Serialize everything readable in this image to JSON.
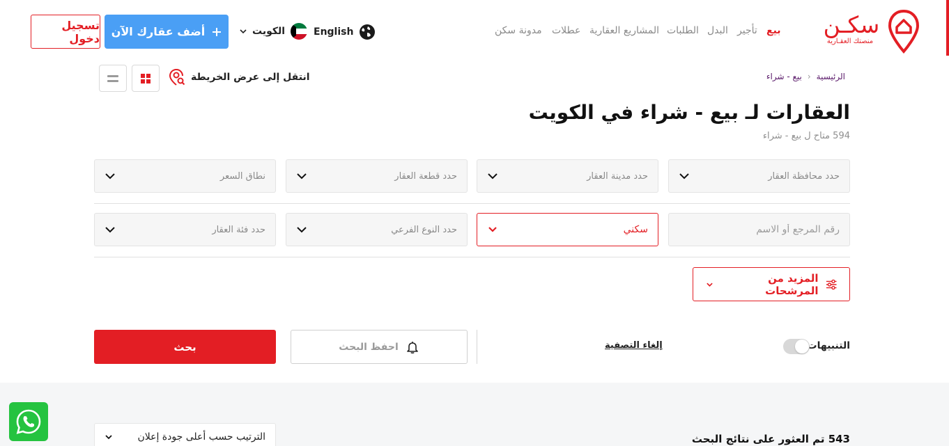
{
  "header": {
    "logo_text": "سكـن",
    "logo_tagline": "منصتك العقـارية",
    "nav": [
      {
        "label": "بيع",
        "active": true
      },
      {
        "label": "تأجير",
        "active": false
      },
      {
        "label": "البدل",
        "active": false
      },
      {
        "label": "الطلبات",
        "active": false
      },
      {
        "label": "المشاريع العقارية",
        "active": false
      },
      {
        "label": "عطلات",
        "active": false
      },
      {
        "label": "مدونة سكن",
        "active": false
      }
    ],
    "language": "English",
    "country": "الكويت",
    "add_property_label": "أضف عقارك الآن",
    "login_label": "تسجيل دخول"
  },
  "breadcrumb": {
    "home": "الرئيسية",
    "current": "بيع - شراء"
  },
  "view": {
    "map_link": "انتقل إلى عرض الخريطة"
  },
  "page": {
    "title": "العقارات لـ بيع - شراء في الكويت",
    "subtitle": "594 متاح ل بيع - شراء"
  },
  "filters": {
    "governorate": "حدد محافظة العقار",
    "city": "حدد مدينة العقار",
    "block": "حدد قطعة العقار",
    "price_range": "نطاق السعر",
    "search_placeholder": "رقم المرجع أو الاسم",
    "type_selected": "سكني",
    "subtype": "حدد النوع الفرعي",
    "category": "حدد فئة العقار",
    "more_filters": "المزيد من المرشحات"
  },
  "actions": {
    "alerts_label": "التنبيهات",
    "clear_filters": "إلغاء التصفية",
    "save_search": "احفظ البحث",
    "search": "بحث"
  },
  "results": {
    "count_text": "543 تم العثور على نتائج البحث",
    "sort_label": "الترتيب حسب أعلى جودة إعلان"
  },
  "colors": {
    "brand": "#e31e24",
    "accent_blue": "#4a9ff5",
    "whatsapp": "#25c340"
  }
}
